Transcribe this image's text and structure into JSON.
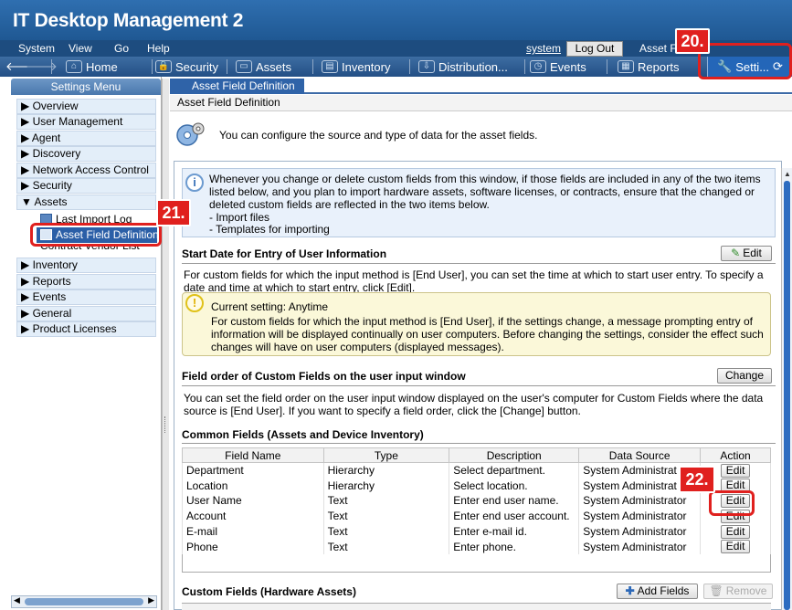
{
  "app": {
    "title": "IT Desktop Management 2"
  },
  "menubar": {
    "items": [
      "System",
      "View",
      "Go",
      "Help"
    ],
    "user": "system",
    "logout": "Log Out",
    "asset_field": "Asset F"
  },
  "toolbar": {
    "home": "Home",
    "security": "Security",
    "assets": "Assets",
    "inventory": "Inventory",
    "distribution": "Distribution...",
    "events": "Events",
    "reports": "Reports",
    "settings": "Setti..."
  },
  "sidebar": {
    "header": "Settings Menu",
    "items": [
      {
        "label": "▶ Overview"
      },
      {
        "label": "▶ User Management"
      },
      {
        "label": "▶ Agent"
      },
      {
        "label": "▶ Discovery"
      },
      {
        "label": "▶ Network Access Control"
      },
      {
        "label": "▶ Security"
      },
      {
        "label": "▼ Assets"
      },
      {
        "label": "▶ Inventory"
      },
      {
        "label": "▶ Reports"
      },
      {
        "label": "▶ Events"
      },
      {
        "label": "▶ General"
      },
      {
        "label": "▶ Product Licenses"
      }
    ],
    "sub_items": {
      "last_import": "Last Import Log",
      "asset_field_definition": "Asset Field Definition",
      "contract_vendor": "Contract Vendor List"
    }
  },
  "main": {
    "tab": "Asset Field Definition",
    "page_title": "Asset Field Definition",
    "intro": "You can configure the source and type of data for the asset fields.",
    "info_lines": [
      "Whenever you change or delete custom fields from this window, if those fields are included in any of the two items",
      "listed below, and you plan to import hardware assets, software licenses, or contracts, ensure that the changed or",
      "deleted custom fields are reflected in the two items below.",
      "- Import files",
      "- Templates for importing"
    ],
    "start_date": {
      "title": "Start Date for Entry of User Information",
      "edit": "Edit",
      "desc1": "For custom fields for which the input method is [End User], you can set the time at which to start user entry. To specify a",
      "desc2": "date and time at which to start entry, click [Edit].",
      "current": "Current setting: Anytime",
      "warn1": "For custom fields for which the input method is [End User], if the settings change, a message prompting entry of",
      "warn2": "information will be displayed continually on user computers. Before changing the settings, consider the effect such",
      "warn3": "changes will have on user computers (displayed messages)."
    },
    "field_order": {
      "title": "Field order of Custom Fields on the user input window",
      "change": "Change",
      "desc1": "You can set the field order on the user input window displayed on the user's computer for Custom Fields where the data",
      "desc2": "source is [End User]. If you want to specify a field order, click the [Change] button."
    },
    "common": {
      "title": "Common Fields (Assets and Device Inventory)",
      "headers": [
        "Field Name",
        "Type",
        "Description",
        "Data Source",
        "Action"
      ],
      "rows": [
        [
          "Department",
          "Hierarchy",
          "Select department.",
          "System Administrat",
          "Edit"
        ],
        [
          "Location",
          "Hierarchy",
          "Select location.",
          "System Administrat",
          "Edit"
        ],
        [
          "User Name",
          "Text",
          "Enter end user name.",
          "System Administrator",
          "Edit"
        ],
        [
          "Account",
          "Text",
          "Enter end user account.",
          "System Administrator",
          "Edit"
        ],
        [
          "E-mail",
          "Text",
          "Enter e-mail id.",
          "System Administrator",
          "Edit"
        ],
        [
          "Phone",
          "Text",
          "Enter phone.",
          "System Administrator",
          "Edit"
        ]
      ]
    },
    "custom": {
      "title": "Custom Fields (Hardware Assets)",
      "add": "Add Fields",
      "remove": "Remove"
    }
  },
  "callouts": {
    "c20": "20.",
    "c21": "21.",
    "c22": "22."
  },
  "colors": {
    "titlebar": "#2f6fb0",
    "accent": "#2f63a8",
    "callout": "#e0201e"
  }
}
